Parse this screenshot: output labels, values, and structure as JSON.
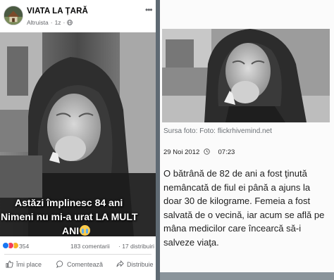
{
  "post": {
    "page_name": "VIATA LA ȚARĂ",
    "author": "Altruista",
    "time": "1z",
    "more_icon": "ellipsis-icon",
    "caption_line1": "Astăzi împlinesc 84 ani",
    "caption_line2": "Nimeni nu mi-a urat LA MULT",
    "caption_line3": "ANI",
    "caption_emoji": "crying-face-emoji",
    "reaction_count": "354",
    "comments": "183 comentarii",
    "shares": "· 17 distribuiri",
    "actions": {
      "like": "Îmi place",
      "comment": "Comentează",
      "share": "Distribuie"
    }
  },
  "article": {
    "photo_source": "Sursa foto: Foto: flickrhivemind.net",
    "date": "29 Noi 2012",
    "time": "07:23",
    "body_lines": [
      "O bătrână de 82 de ani a fost ţinută",
      "nemâncată de fiul ei până a ajuns la",
      "doar 30 de kilograme. Femeia a fost",
      "salvată de o vecină, iar acum se află pe",
      "mâna medicilor care încearcă să-i",
      "salveze viaţa."
    ]
  },
  "colors": {
    "facebook_blue": "#1877f2",
    "love_red": "#f33e58",
    "sad_yellow": "#f7b125",
    "separator": "#5f6a73"
  }
}
